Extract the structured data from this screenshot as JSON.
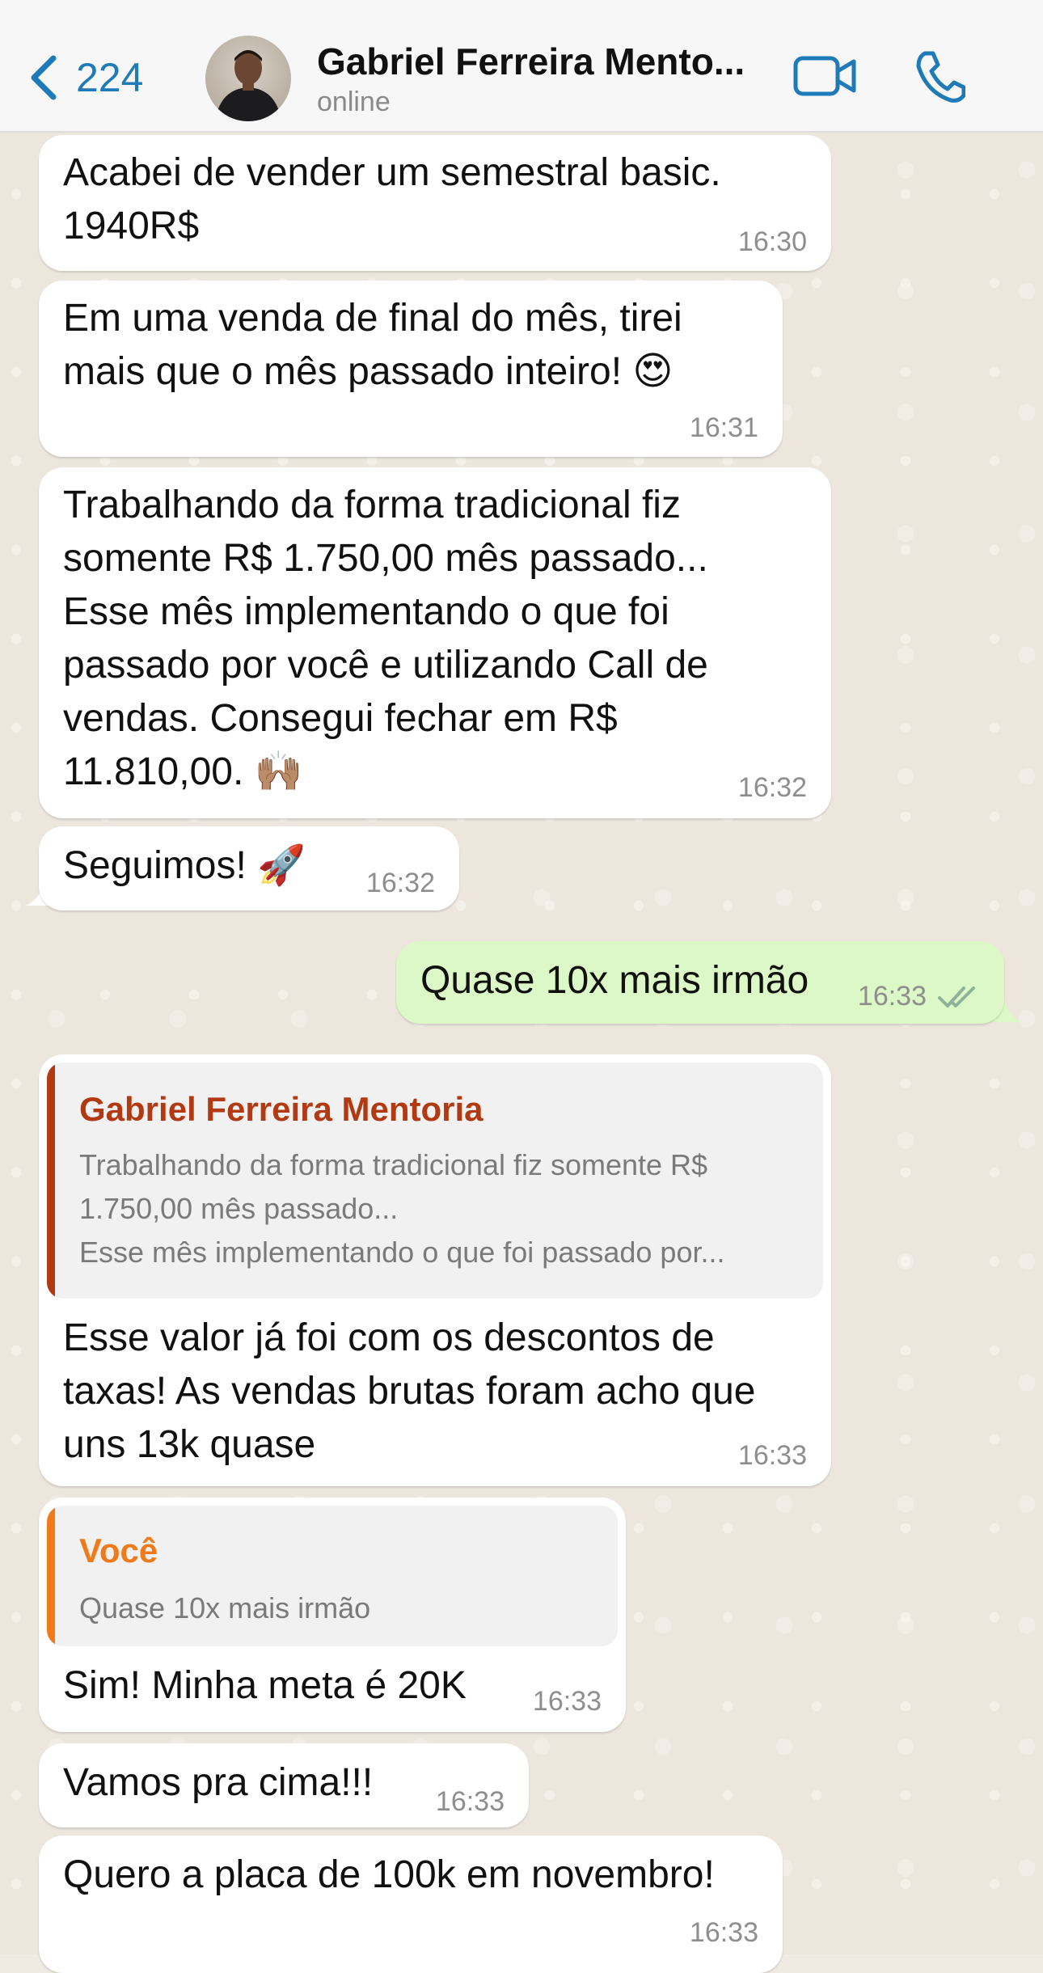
{
  "header": {
    "back_count": "224",
    "contact_name": "Gabriel Ferreira Mento...",
    "status": "online"
  },
  "messages": [
    {
      "direction": "in",
      "text": "Acabei de vender um semestral basic.\n1940R$",
      "time": "16:30"
    },
    {
      "direction": "in",
      "text": "Em uma venda de final do mês, tirei\nmais que o mês passado inteiro! 😍",
      "time": "16:31"
    },
    {
      "direction": "in",
      "text": "Trabalhando da forma tradicional fiz\nsomente R$ 1.750,00 mês passado...\nEsse mês implementando o que foi\npassado por você e utilizando Call de\nvendas. Consegui fechar em R$\n11.810,00. 🙌🏽",
      "time": "16:32"
    },
    {
      "direction": "in",
      "text": "Seguimos! 🚀",
      "time": "16:32"
    },
    {
      "direction": "out",
      "text": "Quase 10x mais irmão",
      "time": "16:33",
      "read": true
    },
    {
      "direction": "in",
      "quote": {
        "author": "Gabriel Ferreira Mentoria",
        "text": "Trabalhando da forma tradicional fiz somente R$\n1.750,00 mês passado...\nEsse mês implementando o que foi passado por...",
        "color": "#b23a12"
      },
      "text": "Esse valor já foi com os descontos de\ntaxas! As vendas brutas foram acho que\nuns 13k quase",
      "time": "16:33"
    },
    {
      "direction": "in",
      "quote": {
        "author": "Você",
        "text": "Quase 10x mais irmão",
        "color": "#f07a1a"
      },
      "text": "Sim! Minha meta é 20K",
      "time": "16:33"
    },
    {
      "direction": "in",
      "text": "Vamos pra cima!!!",
      "time": "16:33"
    },
    {
      "direction": "in",
      "text": "Quero a placa de 100k em novembro!",
      "time": "16:33"
    }
  ],
  "colors": {
    "accent": "#1f7ab8",
    "incoming_bubble": "#ffffff",
    "outgoing_bubble": "#dcf8c6",
    "read_ticks": "#8fb39a"
  },
  "icons": {
    "back": "chevron-left-icon",
    "video": "video-camera-icon",
    "call": "phone-icon",
    "read_receipt": "double-check-icon"
  }
}
